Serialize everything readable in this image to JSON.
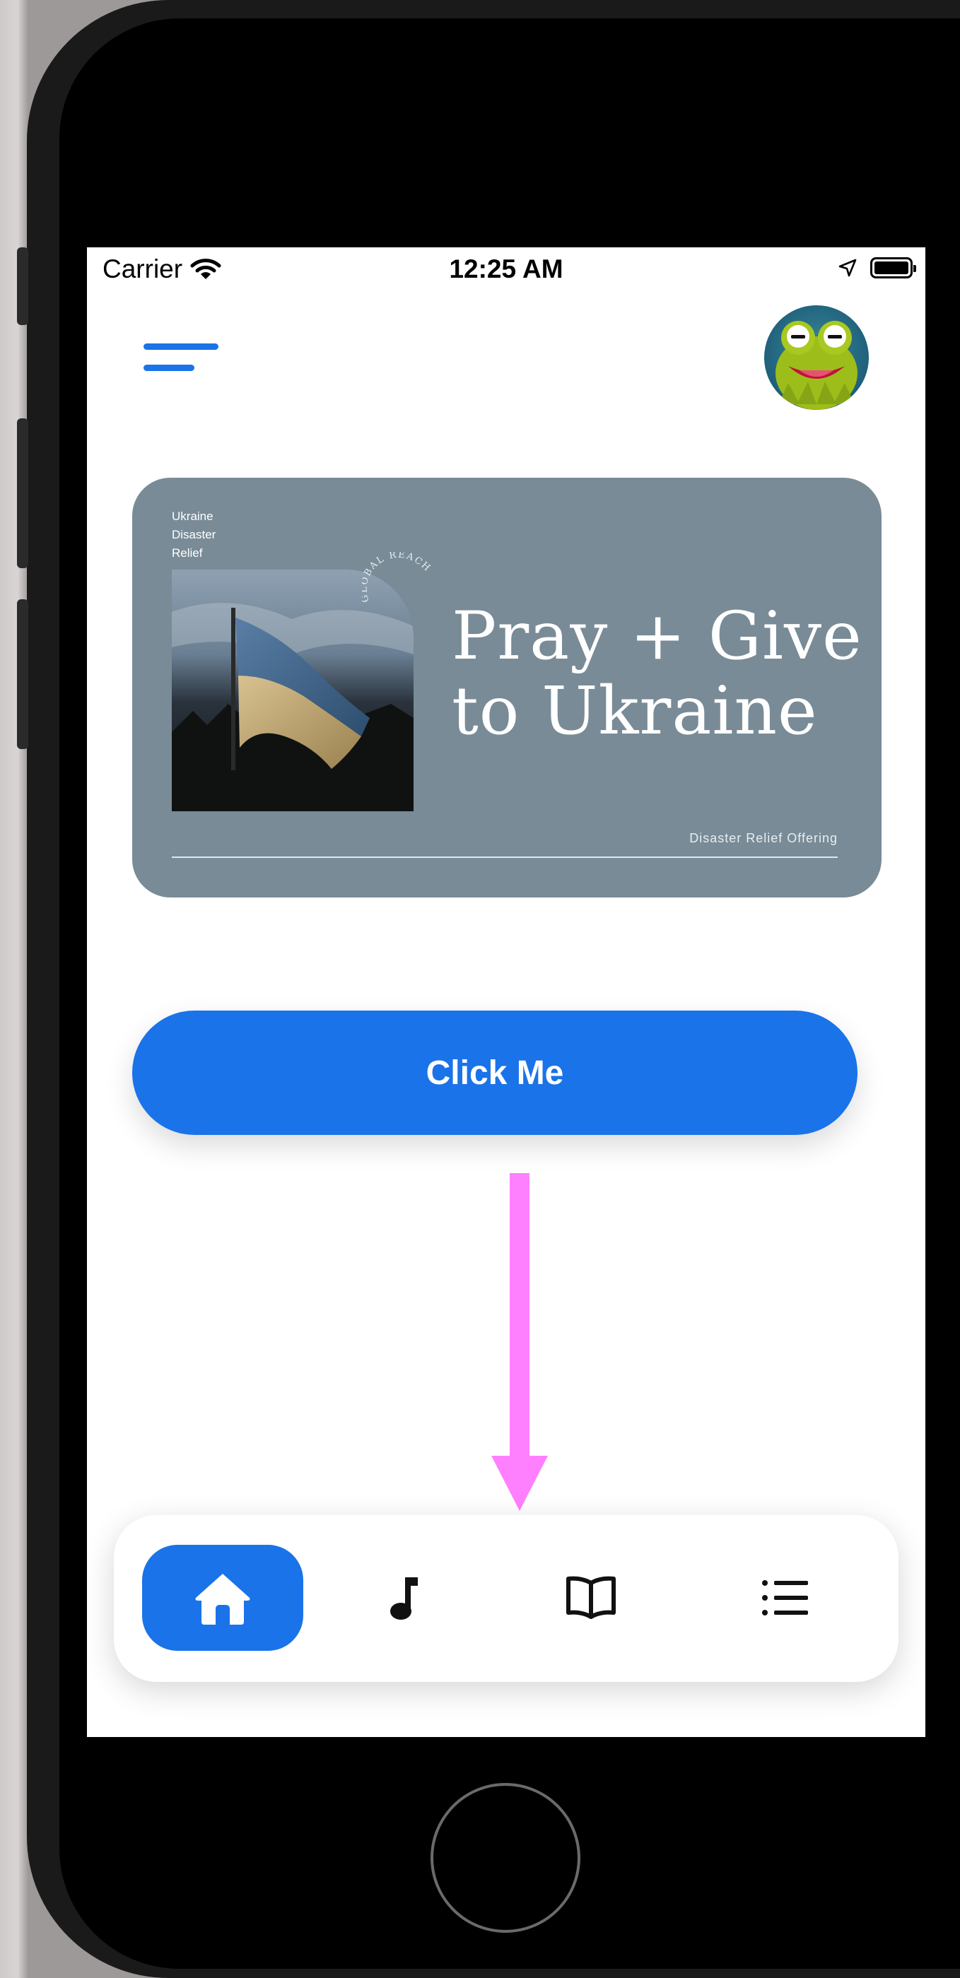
{
  "status_bar": {
    "carrier": "Carrier",
    "time": "12:25 AM"
  },
  "banner": {
    "small_lines": [
      "Ukraine",
      "Disaster",
      "Relief"
    ],
    "arc_text": "GLOBAL REACH",
    "headline_line1": "Pray + Give",
    "headline_line2": "to Ukraine",
    "footer_text": "Disaster Relief Offering",
    "background_color": "#788b97"
  },
  "main": {
    "click_button_label": "Click Me"
  },
  "tab_bar": {
    "items": [
      {
        "icon": "home-icon",
        "active": true
      },
      {
        "icon": "music-note-icon",
        "active": false
      },
      {
        "icon": "book-icon",
        "active": false
      },
      {
        "icon": "list-icon",
        "active": false
      }
    ]
  },
  "colors": {
    "accent": "#1a73e8",
    "annotation_arrow": "#ff80ff"
  }
}
